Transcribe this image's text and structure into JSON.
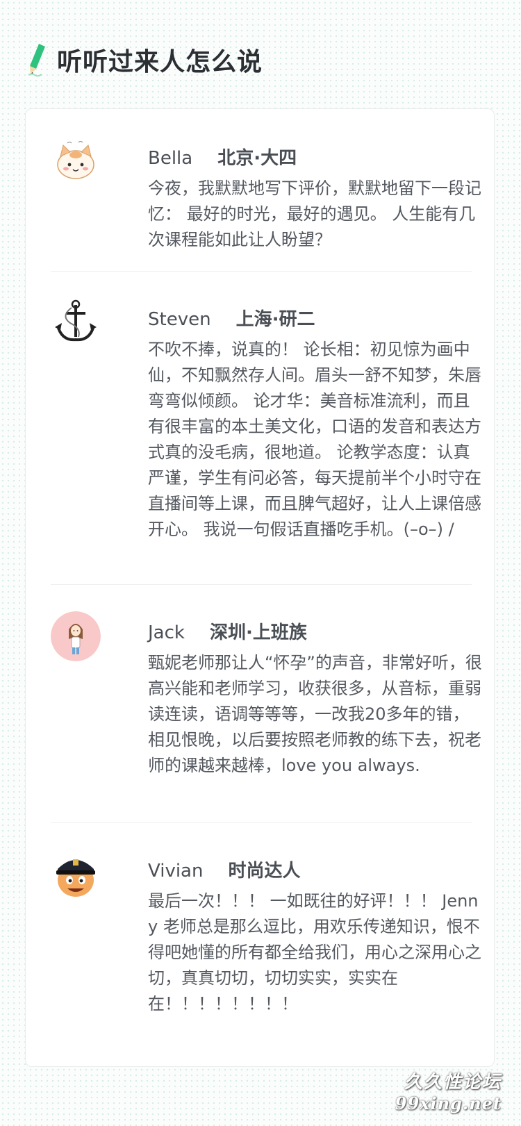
{
  "header": {
    "title": "听听过来人怎么说",
    "icon": "pen-icon"
  },
  "colors": {
    "accent": "#2ec27e",
    "title": "#2b2e33",
    "body_text": "#54585f",
    "card_border": "#e8ecea"
  },
  "reviews": [
    {
      "avatar": "cat-avatar-icon",
      "name": "Bella",
      "location": "北京·大四",
      "text": "今夜，我默默地写下评价，默默地留下一段记忆： 最好的时光，最好的遇见。 人生能有几次课程能如此让人盼望？"
    },
    {
      "avatar": "anchor-avatar-icon",
      "name": "Steven",
      "location": "上海·研二",
      "text": "不吹不捧，说真的！ 论长相：初见惊为画中仙，不知飘然存人间。眉头一舒不知梦，朱唇弯弯似倾颜。 论才华：美音标准流利，而且有很丰富的本土美文化，口语的发音和表达方式真的没毛病，很地道。 论教学态度：认真严谨，学生有问必答，每天提前半个小时守在直播间等上课，而且脾气超好，让人上课倍感开心。 我说一句假话直播吃手机。(–o–) /"
    },
    {
      "avatar": "girl-avatar-icon",
      "name": "Jack",
      "location": "深圳·上班族",
      "text": "甄妮老师那让人“怀孕”的声音，非常好听，很高兴能和老师学习，收获很多，从音标，重弱读连读，语调等等等，一改我20多年的错，相见恨晚，以后要按照老师教的练下去，祝老师的课越来越棒，love you always."
    },
    {
      "avatar": "police-avatar-icon",
      "name": "Vivian",
      "location": "时尚达人",
      "text": "最后一次！！！ 一如既往的好评！！！ Jenny 老师总是那么逗比，用欢乐传递知识，恨不得吧她懂的所有都全给我们，用心之深用心之切，真真切切，切切实实，实实在在！！！！！！！！"
    }
  ],
  "watermark": {
    "line1": "久久性论坛",
    "line2": "99xing.net"
  }
}
